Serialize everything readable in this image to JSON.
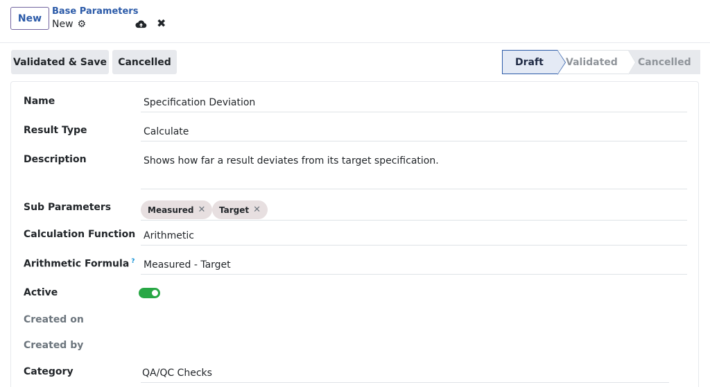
{
  "control_panel": {
    "new_button": "New",
    "breadcrumb_parent": "Base Parameters",
    "breadcrumb_current": "New",
    "gear_icon": "⚙",
    "discard_icon": "✖"
  },
  "actions": {
    "validate_save": "Validated & Save",
    "cancelled": "Cancelled"
  },
  "statusbar": {
    "stages": [
      "Draft",
      "Validated",
      "Cancelled"
    ],
    "current": "Draft"
  },
  "form": {
    "name_label": "Name",
    "name_value": "Specification Deviation",
    "result_type_label": "Result Type",
    "result_type_value": "Calculate",
    "description_label": "Description",
    "description_value": "Shows how far a result deviates from its target specification.",
    "sub_parameters_label": "Sub Parameters",
    "sub_parameters": [
      "Measured",
      "Target"
    ],
    "calc_function_label": "Calculation Function",
    "calc_function_value": "Arithmetic",
    "formula_label": "Arithmetic Formula",
    "formula_help": "?",
    "formula_value": "Measured - Target",
    "active_label": "Active",
    "active_value": true,
    "created_on_label": "Created on",
    "created_by_label": "Created by",
    "category_label": "Category",
    "category_value": "QA/QC Checks"
  },
  "colors": {
    "accent": "#71639e",
    "link": "#2b5aa8",
    "toggle_on": "#28a745"
  }
}
